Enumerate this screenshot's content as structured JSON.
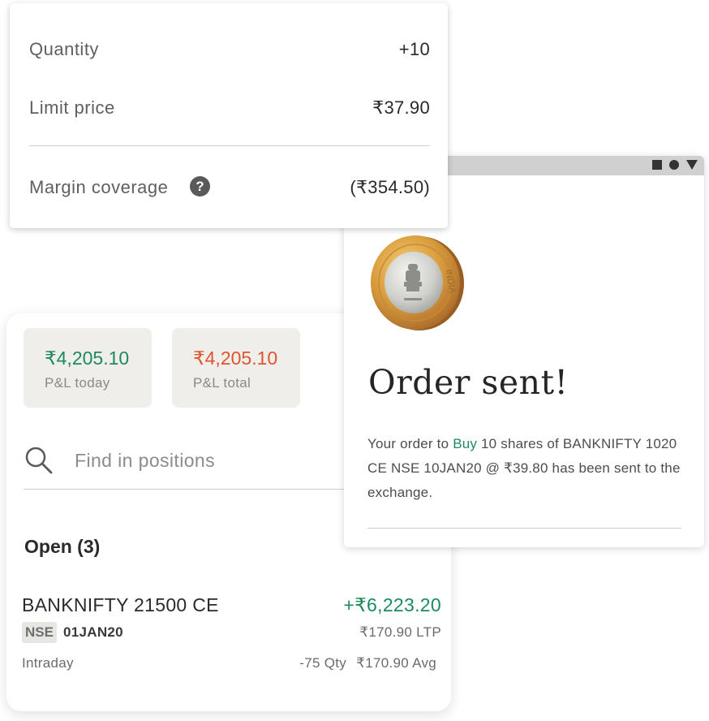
{
  "order_details": {
    "quantity_label": "Quantity",
    "quantity_value": "+10",
    "limit_price_label": "Limit price",
    "limit_price_value": "₹37.90",
    "margin_label": "Margin coverage",
    "margin_help_icon": "question-circle-icon",
    "margin_value": "(₹354.50)"
  },
  "positions": {
    "pnl_today": {
      "value": "₹4,205.10",
      "label": "P&L today"
    },
    "pnl_total": {
      "value": "₹4,205.10",
      "label": "P&L total"
    },
    "search": {
      "icon": "search-icon",
      "placeholder": "Find in positions"
    },
    "open_heading": "Open (3)",
    "rows": [
      {
        "symbol": "BANKNIFTY 21500 CE",
        "pnl": "+₹6,223.20",
        "exchange": "NSE",
        "expiry": "01JAN20",
        "ltp": "₹170.90 LTP",
        "product": "Intraday",
        "qty": "-75 Qty",
        "avg": "₹170.90 Avg"
      }
    ]
  },
  "order_window": {
    "controls": [
      "square-icon",
      "circle-icon",
      "triangle-down-icon"
    ],
    "coin_image": "india-ten-rupee-coin",
    "coin_text": "INDIA",
    "title": "Order sent!",
    "message_prefix": "Your order to ",
    "message_action": "Buy",
    "message_suffix": " 10 shares of BANKNIFTY 1020 CE NSE 10JAN20 @ ₹39.80 has been sent to the exchange."
  },
  "colors": {
    "profit_green": "#1e8a5c",
    "loss_orange": "#e0552b",
    "tile_background": "#efeeea",
    "window_bar": "#d0d0d0"
  }
}
